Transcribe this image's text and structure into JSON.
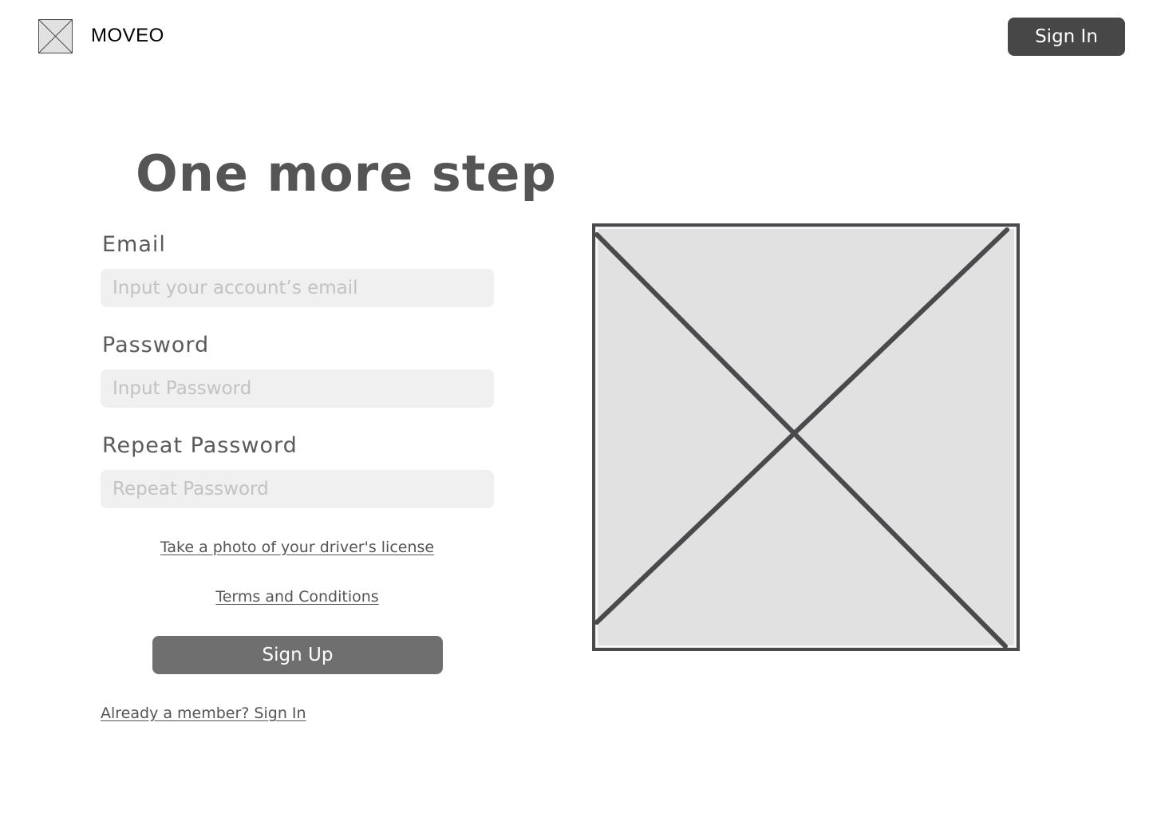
{
  "header": {
    "brand": "MOVEO",
    "logo_icon": "image-placeholder-icon",
    "signin_label": "Sign In"
  },
  "main": {
    "title": "One more step",
    "form": {
      "email": {
        "label": "Email",
        "placeholder": "Input your account’s email",
        "value": ""
      },
      "password": {
        "label": "Password",
        "placeholder": "Input Password",
        "value": ""
      },
      "repeat_password": {
        "label": "Repeat Password",
        "placeholder": "Repeat Password",
        "value": ""
      },
      "license_link": "Take a photo of your driver's license",
      "terms_link": "Terms and Conditions",
      "submit_label": "Sign Up",
      "signin_link": "Already a member? Sign In"
    },
    "image_icon": "image-placeholder-icon"
  },
  "colors": {
    "primary_button": "#474747",
    "secondary_button": "#6f6f6f",
    "input_background": "#f0f0f0",
    "text": "#555555",
    "placeholder_fill": "#e1e1e1",
    "placeholder_stroke": "#4a4a4d"
  }
}
